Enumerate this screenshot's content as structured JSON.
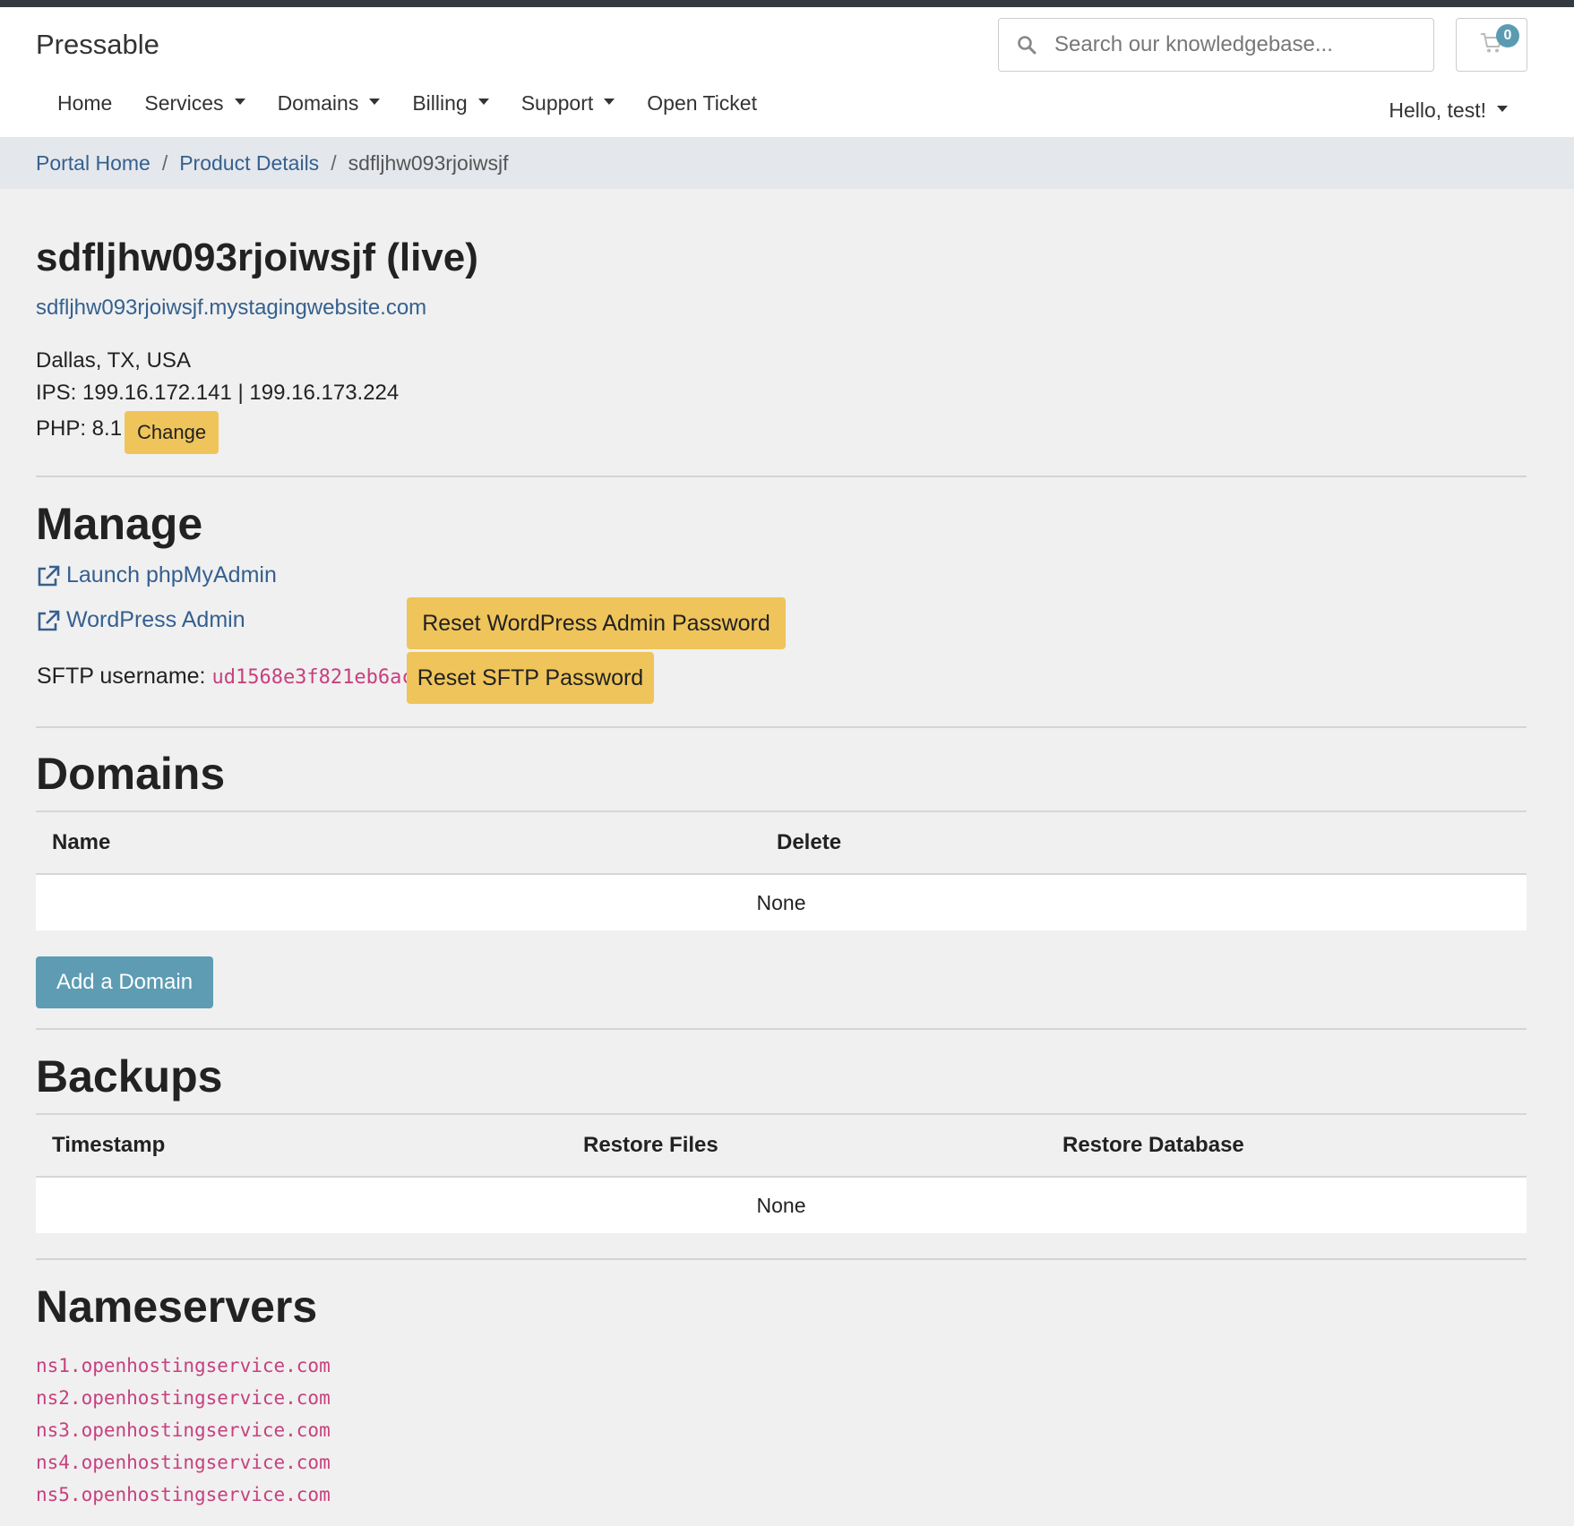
{
  "header": {
    "brand": "Pressable",
    "search_placeholder": "Search our knowledgebase...",
    "cart_count": "0"
  },
  "nav": {
    "home": "Home",
    "services": "Services",
    "domains": "Domains",
    "billing": "Billing",
    "support": "Support",
    "open_ticket": "Open Ticket",
    "user": "Hello, test!"
  },
  "breadcrumb": {
    "portal_home": "Portal Home",
    "product_details": "Product Details",
    "current": "sdfljhw093rjoiwsjf"
  },
  "product": {
    "title": "sdfljhw093rjoiwsjf (live)",
    "url": "sdfljhw093rjoiwsjf.mystagingwebsite.com",
    "location": "Dallas, TX, USA",
    "ips": "IPS: 199.16.172.141 | 199.16.173.224",
    "php": "PHP: 8.1",
    "change_label": "Change"
  },
  "manage": {
    "title": "Manage",
    "phpmyadmin": "Launch phpMyAdmin",
    "wp_admin": "WordPress Admin",
    "reset_wp": "Reset WordPress Admin Password",
    "sftp_label": "SFTP username:",
    "sftp_user": "ud1568e3f821eb6ac",
    "reset_sftp": "Reset SFTP Password"
  },
  "domains": {
    "title": "Domains",
    "col_name": "Name",
    "col_delete": "Delete",
    "empty": "None",
    "add_label": "Add a Domain"
  },
  "backups": {
    "title": "Backups",
    "col_timestamp": "Timestamp",
    "col_restore_files": "Restore Files",
    "col_restore_db": "Restore Database",
    "empty": "None"
  },
  "nameservers": {
    "title": "Nameservers",
    "items": [
      "ns1.openhostingservice.com",
      "ns2.openhostingservice.com",
      "ns3.openhostingservice.com",
      "ns4.openhostingservice.com",
      "ns5.openhostingservice.com"
    ]
  },
  "colors": {
    "link": "#35608f",
    "warning_button": "#efc45a",
    "info_button": "#5d9cb3",
    "code_text": "#c7407f",
    "topbar": "#343a40"
  },
  "icons": {
    "search": "search-icon",
    "cart": "cart-icon",
    "external_link": "external-link-icon",
    "caret": "caret-down-icon"
  }
}
